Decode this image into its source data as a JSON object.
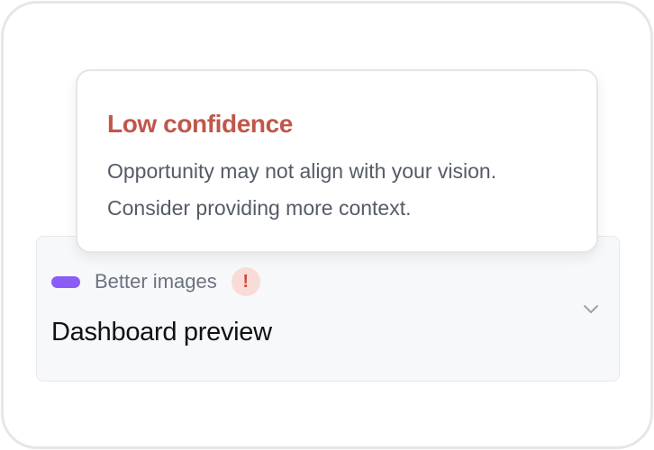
{
  "tooltip": {
    "title": "Low confidence",
    "lines": [
      "Opportunity may not align with your vision.",
      "Consider providing more context."
    ]
  },
  "card": {
    "tag_label": "Better images",
    "title": "Dashboard preview",
    "alert_glyph": "!",
    "expand_icon": "chevron-down-icon",
    "tag_icon": "pill-icon"
  },
  "colors": {
    "warning_title": "#c0574a",
    "pill": "#8b5cf6",
    "alert_bg": "#f9dcd7",
    "alert_fg": "#d2483a",
    "chevron": "#9ca3af"
  }
}
